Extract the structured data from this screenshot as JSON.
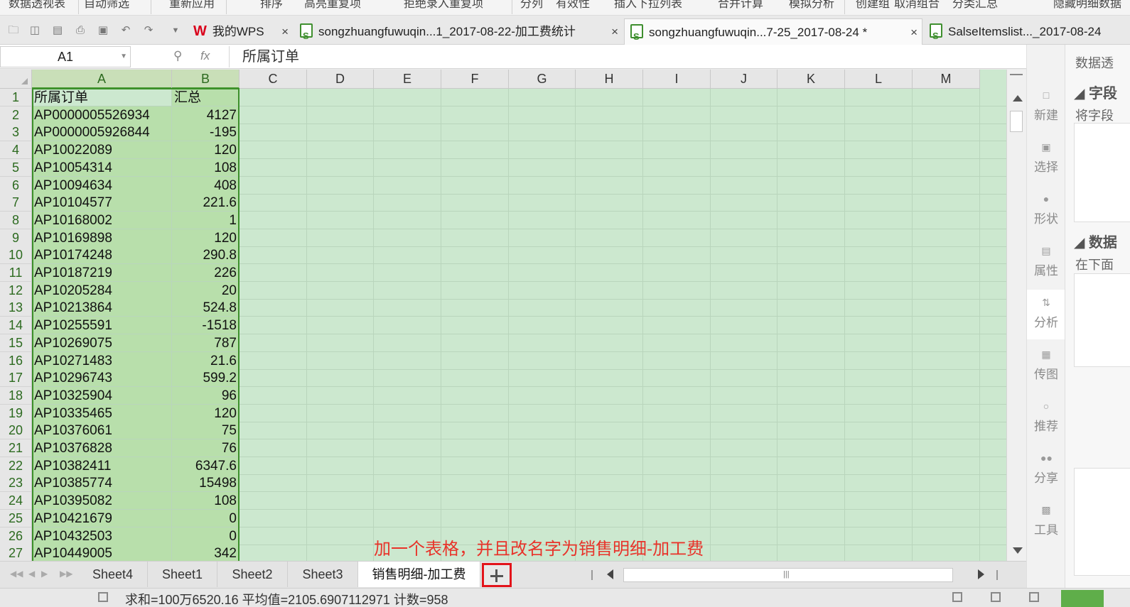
{
  "window": {
    "ribbon_partial": [
      "数据透视表",
      "自动筛选",
      "重新应用",
      "排序",
      "高亮重复项",
      "拒绝录入重复项",
      "分列",
      "有效性",
      "插入下拉列表",
      "合并计算",
      "模拟分析",
      "创建组",
      "取消组合",
      "分类汇总",
      "隐藏明细数据"
    ]
  },
  "tabs": [
    {
      "label": "我的WPS",
      "type": "wps"
    },
    {
      "label": "songzhuangfuwuqin...1_2017-08-22-加工费统计",
      "type": "xls"
    },
    {
      "label": "songzhuangfuwuqin...7-25_2017-08-24 *",
      "type": "xls",
      "active": true
    },
    {
      "label": "SalseItemslist..._2017-08-24",
      "type": "xls"
    }
  ],
  "tab_close": "×",
  "formula_bar": {
    "name_box": "A1",
    "content": "所属订单"
  },
  "columns": [
    "A",
    "B",
    "C",
    "D",
    "E",
    "F",
    "G",
    "H",
    "I",
    "J",
    "K",
    "L",
    "M"
  ],
  "rows": [
    {
      "n": "1",
      "a": "所属订单",
      "b": "汇总"
    },
    {
      "n": "2",
      "a": "AP0000005526934",
      "b": "4127"
    },
    {
      "n": "3",
      "a": "AP0000005926844",
      "b": "-195"
    },
    {
      "n": "4",
      "a": "AP10022089",
      "b": "120"
    },
    {
      "n": "5",
      "a": "AP10054314",
      "b": "108"
    },
    {
      "n": "6",
      "a": "AP10094634",
      "b": "408"
    },
    {
      "n": "7",
      "a": "AP10104577",
      "b": "221.6"
    },
    {
      "n": "8",
      "a": "AP10168002",
      "b": "1"
    },
    {
      "n": "9",
      "a": "AP10169898",
      "b": "120"
    },
    {
      "n": "10",
      "a": "AP10174248",
      "b": "290.8"
    },
    {
      "n": "11",
      "a": "AP10187219",
      "b": "226"
    },
    {
      "n": "12",
      "a": "AP10205284",
      "b": "20"
    },
    {
      "n": "13",
      "a": "AP10213864",
      "b": "524.8"
    },
    {
      "n": "14",
      "a": "AP10255591",
      "b": "-1518"
    },
    {
      "n": "15",
      "a": "AP10269075",
      "b": "787"
    },
    {
      "n": "16",
      "a": "AP10271483",
      "b": "21.6"
    },
    {
      "n": "17",
      "a": "AP10296743",
      "b": "599.2"
    },
    {
      "n": "18",
      "a": "AP10325904",
      "b": "96"
    },
    {
      "n": "19",
      "a": "AP10335465",
      "b": "120"
    },
    {
      "n": "20",
      "a": "AP10376061",
      "b": "75"
    },
    {
      "n": "21",
      "a": "AP10376828",
      "b": "76"
    },
    {
      "n": "22",
      "a": "AP10382411",
      "b": "6347.6"
    },
    {
      "n": "23",
      "a": "AP10385774",
      "b": "15498"
    },
    {
      "n": "24",
      "a": "AP10395082",
      "b": "108"
    },
    {
      "n": "25",
      "a": "AP10421679",
      "b": "0"
    },
    {
      "n": "26",
      "a": "AP10432503",
      "b": "0"
    },
    {
      "n": "27",
      "a": "AP10449005",
      "b": "342"
    }
  ],
  "side_panel": {
    "items": [
      {
        "label": "新建",
        "icon": "new-icon"
      },
      {
        "label": "选择",
        "icon": "select-icon"
      },
      {
        "label": "形状",
        "icon": "shape-icon"
      },
      {
        "label": "属性",
        "icon": "property-icon"
      },
      {
        "label": "分析",
        "icon": "analyze-icon",
        "active": true
      },
      {
        "label": "传图",
        "icon": "image-upload-icon"
      },
      {
        "label": "推荐",
        "icon": "recommend-icon"
      },
      {
        "label": "分享",
        "icon": "share-icon"
      },
      {
        "label": "工具",
        "icon": "toolbox-icon"
      }
    ],
    "pivot_title": "数据透",
    "section1_title": "字段",
    "section1_hint": "将字段",
    "section2_title": "数据",
    "section2_hint": "在下面"
  },
  "sheets": [
    {
      "label": "Sheet4"
    },
    {
      "label": "Sheet1"
    },
    {
      "label": "Sheet2"
    },
    {
      "label": "Sheet3"
    },
    {
      "label": "销售明细-加工费",
      "active": true
    }
  ],
  "annotation": "加一个表格，并且改名字为销售明细-加工费",
  "status": {
    "summary": "求和=100万6520.16  平均值=2105.6907112971  计数=958"
  },
  "colors": {
    "grid_bg": "#cce8cf",
    "selection": "#b8dfab",
    "annotation": "#e8332a",
    "highlight_box": "#e3141b"
  }
}
